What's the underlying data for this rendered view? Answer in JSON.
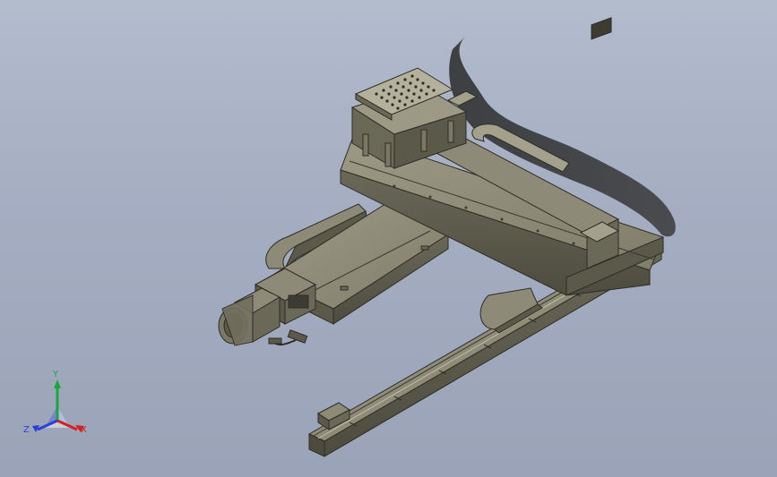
{
  "viewport": {
    "background": "#a4adc1",
    "model": "gantry-stage-assembly"
  },
  "triad": {
    "y_label": "Y",
    "z_label": "Z",
    "x_label": "X",
    "colors": {
      "x": "#d22020",
      "y": "#1aa83a",
      "z": "#2a3fd8"
    }
  },
  "parts": [
    "x-axis-rail",
    "y-axis-module",
    "upper-linear-module",
    "nozzle-head-block",
    "servo-motor",
    "cable-carriers"
  ]
}
